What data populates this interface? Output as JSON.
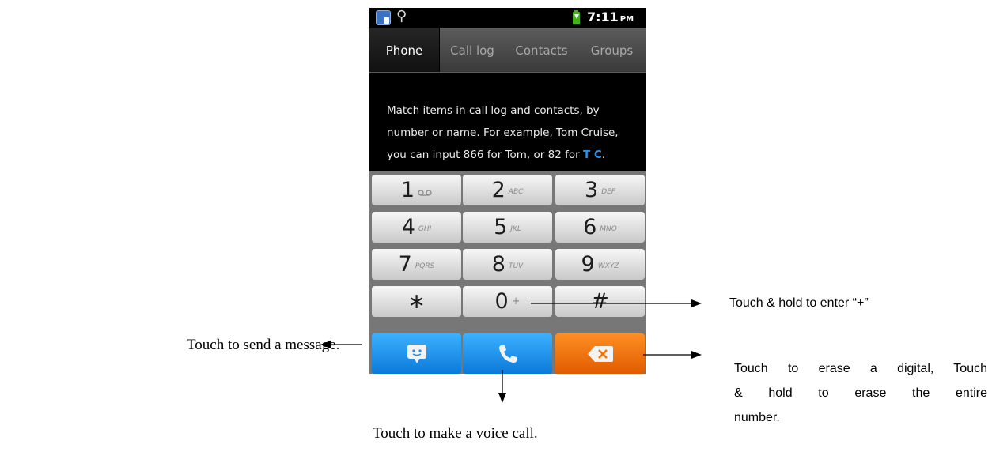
{
  "status_bar": {
    "time": "7:11",
    "ampm": "PM",
    "icons": [
      "notification-app-icon",
      "usb-icon",
      "battery-charging-icon"
    ]
  },
  "tabs": [
    {
      "label": "Phone",
      "active": true
    },
    {
      "label": "Call log",
      "active": false
    },
    {
      "label": "Contacts",
      "active": false
    },
    {
      "label": "Groups",
      "active": false
    }
  ],
  "hint": {
    "text": "Match items in call log and contacts, by number or name. For example, Tom Cruise, you can input 866 for Tom, or 82 for",
    "highlight": "T C",
    "end": "."
  },
  "keypad": [
    {
      "digit": "1",
      "letters": "voicemail-icon"
    },
    {
      "digit": "2",
      "letters": "ABC"
    },
    {
      "digit": "3",
      "letters": "DEF"
    },
    {
      "digit": "4",
      "letters": "GHI"
    },
    {
      "digit": "5",
      "letters": "JKL"
    },
    {
      "digit": "6",
      "letters": "MNO"
    },
    {
      "digit": "7",
      "letters": "PQRS"
    },
    {
      "digit": "8",
      "letters": "TUV"
    },
    {
      "digit": "9",
      "letters": "WXYZ"
    },
    {
      "digit": "∗",
      "letters": ""
    },
    {
      "digit": "0",
      "letters": "+"
    },
    {
      "digit": "#",
      "letters": ""
    }
  ],
  "actions": {
    "message_icon": "message-icon",
    "call_icon": "phone-icon",
    "delete_icon": "backspace-icon",
    "colors": {
      "blue": "#1a8ff0",
      "orange": "#f57400"
    }
  },
  "annotations": {
    "send_message": "Touch to send a message.",
    "voice_call": "Touch to make a voice call.",
    "hold_plus": "Touch & hold to enter “+”",
    "erase_line1": "Touch to erase a digital, Touch",
    "erase_line2": "& hold to erase the entire",
    "erase_line3": "number."
  }
}
